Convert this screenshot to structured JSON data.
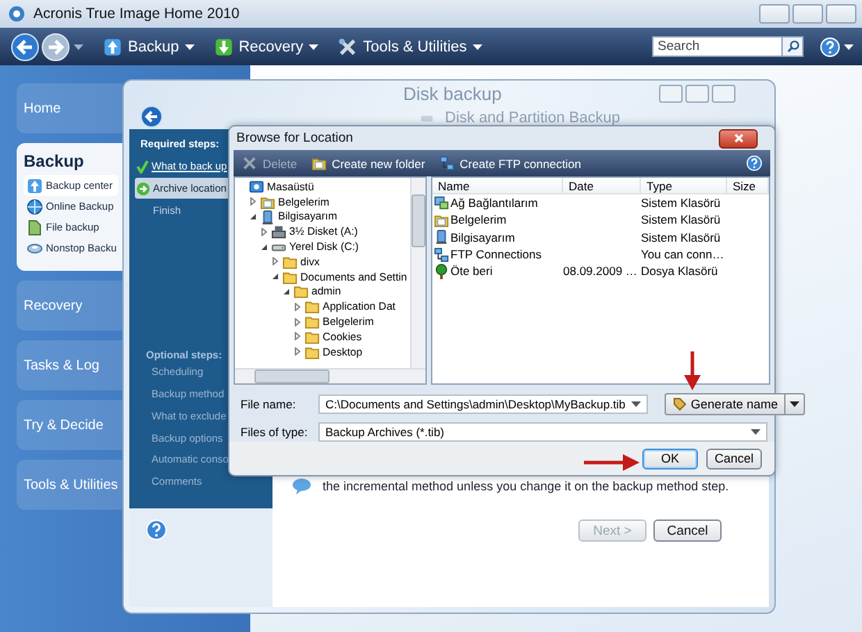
{
  "window": {
    "title": "Acronis True Image Home 2010"
  },
  "toolbar": {
    "items": [
      {
        "kind": "backup",
        "label": "Backup"
      },
      {
        "kind": "recovery",
        "label": "Recovery"
      },
      {
        "kind": "tools",
        "label": "Tools & Utilities"
      }
    ],
    "search": {
      "placeholder": "Search"
    }
  },
  "nav": [
    {
      "label": "Home",
      "expanded": false
    },
    {
      "label": "Backup",
      "expanded": true,
      "items": [
        {
          "kind": "center",
          "label": "Backup center",
          "selected": true
        },
        {
          "kind": "online",
          "label": "Online Backup",
          "selected": false
        },
        {
          "kind": "file",
          "label": "File backup",
          "selected": false
        },
        {
          "kind": "nonstop",
          "label": "Nonstop Backu",
          "selected": false
        }
      ]
    },
    {
      "label": "Recovery",
      "expanded": false
    },
    {
      "label": "Tasks & Log",
      "expanded": false
    },
    {
      "label": "Try & Decide",
      "expanded": false
    },
    {
      "label": "Tools & Utilities",
      "expanded": false
    }
  ],
  "wizard": {
    "title": "Disk backup",
    "heading": "Disk and Partition Backup",
    "required_title": "Required steps:",
    "required_steps": [
      {
        "label": "What to back up",
        "done": true,
        "selected": false
      },
      {
        "label": "Archive location",
        "done": false,
        "selected": true
      },
      {
        "label": "Finish",
        "done": false,
        "selected": false
      }
    ],
    "optional_title": "Optional steps:",
    "optional_steps": [
      "Scheduling",
      "Backup method",
      "What to exclude",
      "Backup options",
      "Automatic conso",
      "Comments"
    ],
    "note": "the incremental method unless you change it on the backup method step.",
    "buttons": [
      {
        "label": "Next >",
        "disabled": true
      },
      {
        "label": "Cancel",
        "disabled": false
      }
    ]
  },
  "browse": {
    "title": "Browse for Location",
    "toolbar": [
      {
        "kind": "delete",
        "label": "Delete",
        "disabled": true
      },
      {
        "kind": "folder",
        "label": "Create new folder",
        "disabled": false
      },
      {
        "kind": "ftp",
        "label": "Create FTP connection",
        "disabled": false
      }
    ],
    "tree": [
      {
        "kind": "desktop",
        "label": "Masaüstü",
        "children": [
          {
            "kind": "documents",
            "label": "Belgelerim",
            "expanded": false
          },
          {
            "kind": "computer",
            "label": "Bilgisayarım",
            "expanded": true,
            "children": [
              {
                "kind": "floppy",
                "label": "3½ Disket (A:)",
                "expanded": false
              },
              {
                "kind": "drive",
                "label": "Yerel Disk (C:)",
                "expanded": true,
                "children": [
                  {
                    "kind": "folder",
                    "label": "divx",
                    "expanded": false
                  },
                  {
                    "kind": "folder",
                    "label": "Documents and Settin",
                    "expanded": true,
                    "children": [
                      {
                        "kind": "folder",
                        "label": "admin",
                        "expanded": true,
                        "children": [
                          {
                            "kind": "folder",
                            "label": "Application Dat",
                            "expanded": false
                          },
                          {
                            "kind": "folder",
                            "label": "Belgelerim",
                            "expanded": false
                          },
                          {
                            "kind": "folder",
                            "label": "Cookies",
                            "expanded": false
                          },
                          {
                            "kind": "folder",
                            "label": "Desktop",
                            "expanded": false
                          }
                        ]
                      }
                    ]
                  }
                ]
              }
            ]
          }
        ]
      }
    ],
    "columns": [
      "Name",
      "Date",
      "Type",
      "Size"
    ],
    "rows": [
      {
        "kind": "network",
        "name": "Ağ Bağlantılarım",
        "type": "Sistem Klasörü"
      },
      {
        "kind": "documents",
        "name": "Belgelerim",
        "type": "Sistem Klasörü"
      },
      {
        "kind": "computer",
        "name": "Bilgisayarım",
        "type": "Sistem Klasörü"
      },
      {
        "kind": "ftp",
        "name": "FTP Connections",
        "type": "You can conn…"
      },
      {
        "kind": "tree",
        "name": "Öte beri",
        "date": "08.09.2009 …",
        "type": "Dosya Klasörü"
      }
    ],
    "file_name": {
      "label": "File name:",
      "value": "C:\\Documents and Settings\\admin\\Desktop\\MyBackup.tib"
    },
    "file_type": {
      "label": "Files of type:",
      "value": "Backup Archives (*.tib)"
    },
    "generate": "Generate name",
    "buttons": [
      "OK",
      "Cancel"
    ]
  }
}
